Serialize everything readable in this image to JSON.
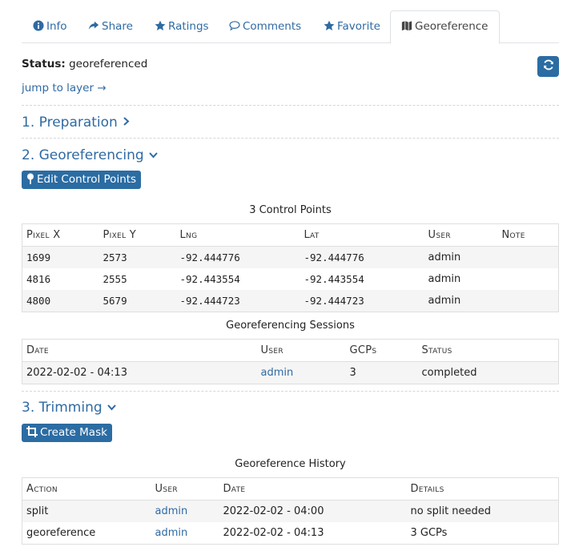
{
  "tabs": [
    {
      "label": "Info",
      "icon": "info-circle-icon"
    },
    {
      "label": "Share",
      "icon": "share-icon"
    },
    {
      "label": "Ratings",
      "icon": "star-icon"
    },
    {
      "label": "Comments",
      "icon": "comment-icon"
    },
    {
      "label": "Favorite",
      "icon": "star-icon"
    },
    {
      "label": "Georeference",
      "icon": "map-icon",
      "active": true
    }
  ],
  "status": {
    "label": "Status:",
    "value": "georeferenced"
  },
  "refresh_icon": "refresh-icon",
  "jump_link": "jump to layer →",
  "sections": {
    "preparation": "1. Preparation",
    "georeferencing": "2. Georeferencing",
    "trimming": "3. Trimming"
  },
  "buttons": {
    "edit_control_points": "Edit Control Points",
    "create_mask": "Create Mask"
  },
  "control_points": {
    "caption": "3 Control Points",
    "columns": [
      "Pixel X",
      "Pixel Y",
      "Lng",
      "Lat",
      "User",
      "Note"
    ],
    "rows": [
      [
        "1699",
        "2573",
        "-92.444776",
        "-92.444776",
        "admin",
        ""
      ],
      [
        "4816",
        "2555",
        "-92.443554",
        "-92.443554",
        "admin",
        ""
      ],
      [
        "4800",
        "5679",
        "-92.444723",
        "-92.444723",
        "admin",
        ""
      ]
    ]
  },
  "sessions": {
    "caption": "Georeferencing Sessions",
    "columns": [
      "Date",
      "User",
      "GCPs",
      "Status"
    ],
    "rows": [
      [
        "2022-02-02 - 04:13",
        "admin",
        "3",
        "completed"
      ]
    ]
  },
  "history": {
    "caption": "Georeference History",
    "columns": [
      "Action",
      "User",
      "Date",
      "Details"
    ],
    "rows": [
      [
        "split",
        "admin",
        "2022-02-02 - 04:00",
        "no split needed"
      ],
      [
        "georeference",
        "admin",
        "2022-02-02 - 04:13",
        "3 GCPs"
      ]
    ]
  },
  "colors": {
    "accent": "#2b6ca3",
    "link": "#2f6aa3"
  }
}
